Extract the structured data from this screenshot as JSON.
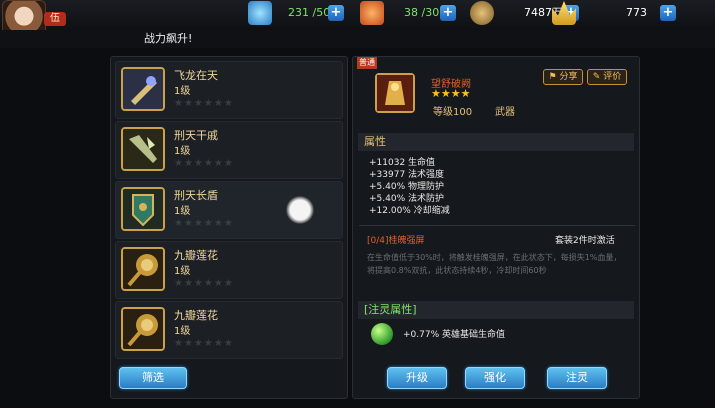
{
  "header": {
    "level_tag": "伍",
    "stamina": "231 /50",
    "energy": "38 /30",
    "gold": "7487万",
    "gems": "773"
  },
  "ticker": "战力飙升!",
  "inventory": {
    "items": [
      {
        "name": "飞龙在天",
        "level": "1级"
      },
      {
        "name": "刑天干戚",
        "level": "1级"
      },
      {
        "name": "刑天长盾",
        "level": "1级"
      },
      {
        "name": "九瓣莲花",
        "level": "1级"
      },
      {
        "name": "九瓣莲花",
        "level": "1级"
      }
    ],
    "filter_label": "筛选"
  },
  "detail": {
    "corner_tag": "普通",
    "name": "望舒破阙",
    "stars": "★★★★",
    "level": "等级100",
    "type": "武器",
    "share_label": "分享",
    "review_label": "评价",
    "attributes_title": "属性",
    "attributes": [
      "+11032 生命值",
      "+33977 法术强度",
      "+5.40% 物理防护",
      "+5.40% 法术防护",
      "+12.00% 冷却缩减"
    ],
    "set_name": "[0/4]桂魄强屏",
    "set_activation": "套装2件时激活",
    "set_desc": "在生命值低于30%时，将触发桂魄强屏，在此状态下，每损失1%血量，将提高0.8%双抗，此状态持续4秒，冷却时间60秒",
    "spirit_title": "[注灵属性]",
    "spirit_effect": "+0.77% 英雄基础生命值",
    "btn_upgrade": "升级",
    "btn_enhance": "强化",
    "btn_infuse": "注灵"
  },
  "colors": {
    "accent_blue": "#3c9ee0",
    "gold_text": "#f2d79a",
    "set_red": "#e0602c",
    "star_yellow": "#f5c518"
  }
}
